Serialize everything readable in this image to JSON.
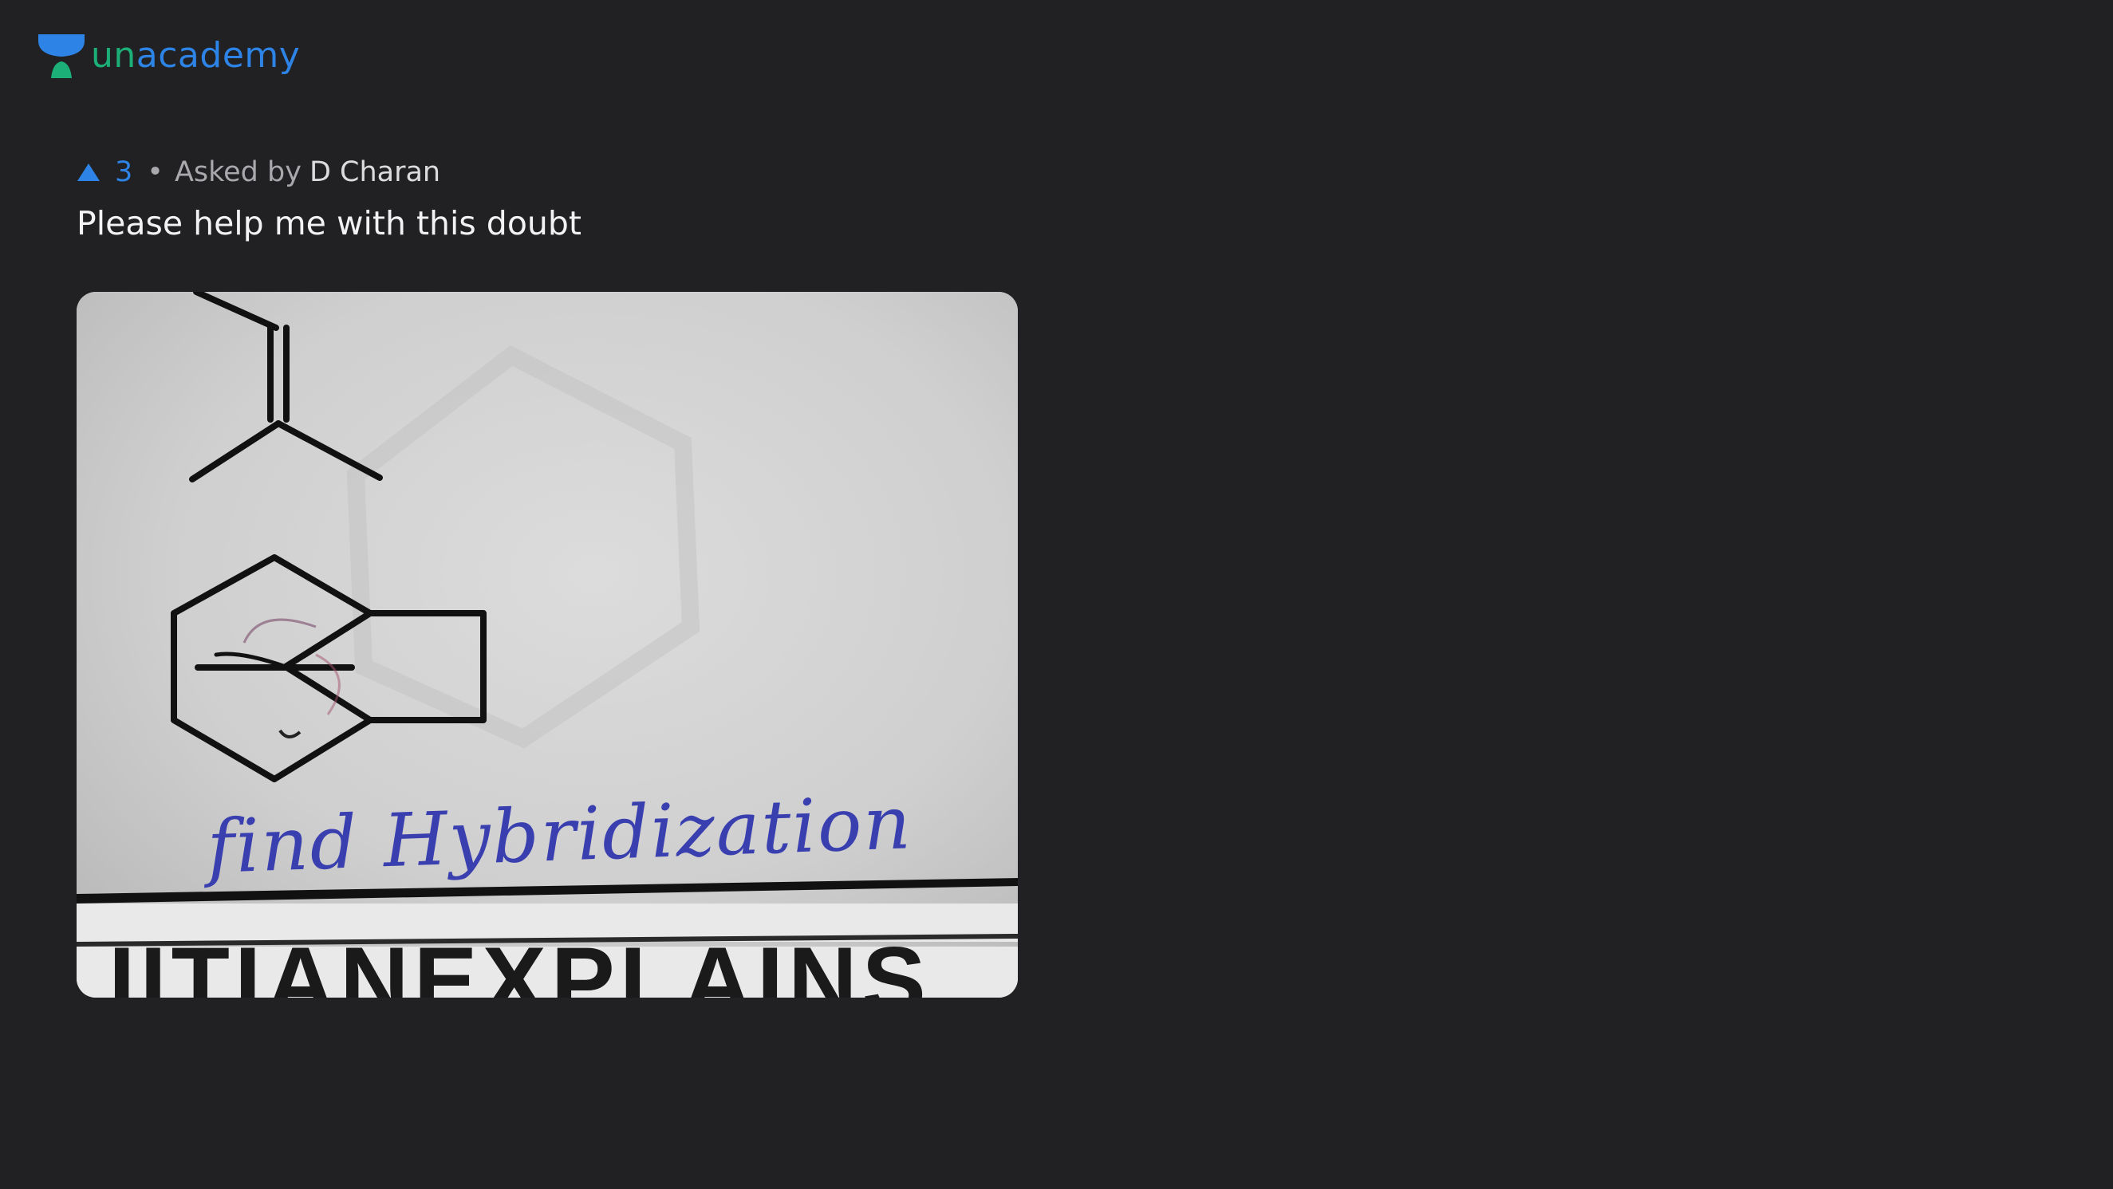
{
  "brand": {
    "name": "unacademy",
    "icon": "unacademy-logo-icon",
    "colors": {
      "text": "#1cb078",
      "mark_top": "#2d84e6",
      "mark_bottom": "#1cb078"
    }
  },
  "question": {
    "upvotes": "3",
    "separator": "•",
    "asked_by_label": "Asked by",
    "author": "D Charan",
    "text": "Please help me with this doubt",
    "image": {
      "handwritten_text": "find Hybridization",
      "watermark_text": "IITIANEXPLAINS"
    }
  },
  "colors": {
    "background": "#212123",
    "accent": "#2d84e6",
    "muted_text": "#a8a8ad",
    "primary_text": "#f2f2f4",
    "ink": "#111111",
    "pen": "#3a3fb0"
  }
}
